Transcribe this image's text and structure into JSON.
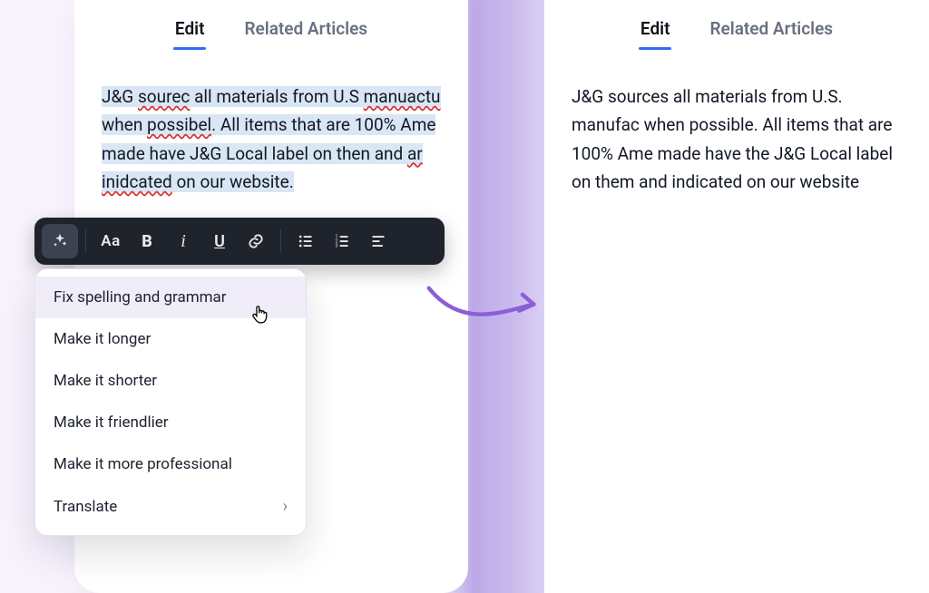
{
  "tabs": {
    "edit": "Edit",
    "related": "Related Articles"
  },
  "left_text": {
    "p1a": "J&G ",
    "p1_typo1": "sourec",
    "p1b": " all materials from U.S ",
    "p1_typo2": "manuactu",
    "p1c": " when ",
    "p1_typo3": "possibel",
    "p1d": ". All items that are 100% Ame",
    "p1e": " made have J&G Local label on then and ",
    "p1_typo4": "ar",
    "p1f": " ",
    "p1_typo5": "inidcated",
    "p1g": " on our website."
  },
  "right_text": {
    "p": "J&G sources all materials from U.S. manufac when possible. All items that are 100% Ame made have the J&G Local label on them and indicated on our website"
  },
  "toolbar": {
    "aa": "Aa",
    "bold": "B",
    "italic": "i",
    "underline": "U"
  },
  "menu": {
    "items": [
      "Fix spelling and grammar",
      "Make it longer",
      "Make it shorter",
      "Make it friendlier",
      "Make it more professional",
      "Translate"
    ]
  }
}
